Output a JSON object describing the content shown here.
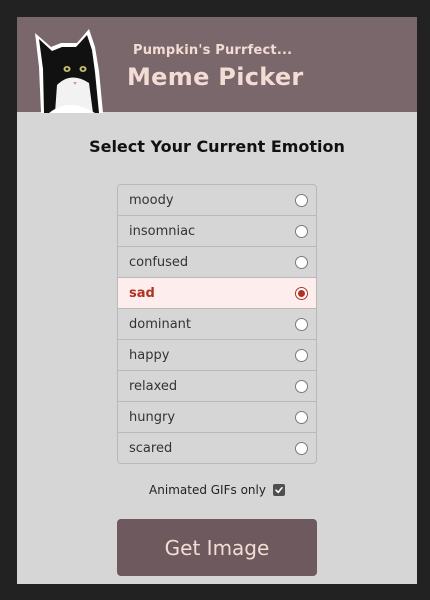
{
  "header": {
    "subtitle": "Pumpkin's Purrfect...",
    "title": "Meme Picker",
    "logo_icon": "cat-photo-icon"
  },
  "prompt": "Select Your Current Emotion",
  "emotions": [
    {
      "label": "moody",
      "selected": false
    },
    {
      "label": "insomniac",
      "selected": false
    },
    {
      "label": "confused",
      "selected": false
    },
    {
      "label": "sad",
      "selected": true
    },
    {
      "label": "dominant",
      "selected": false
    },
    {
      "label": "happy",
      "selected": false
    },
    {
      "label": "relaxed",
      "selected": false
    },
    {
      "label": "hungry",
      "selected": false
    },
    {
      "label": "scared",
      "selected": false
    }
  ],
  "gifs_only": {
    "label": "Animated GIFs only",
    "checked": true
  },
  "button": {
    "label": "Get Image"
  },
  "colors": {
    "background": "#222222",
    "card": "#d6d6d6",
    "header": "#7a676b",
    "accent_text": "#f3dcd4",
    "selected_bg": "#fdedec",
    "selected_text": "#b03226",
    "button": "#6e5a5e"
  }
}
